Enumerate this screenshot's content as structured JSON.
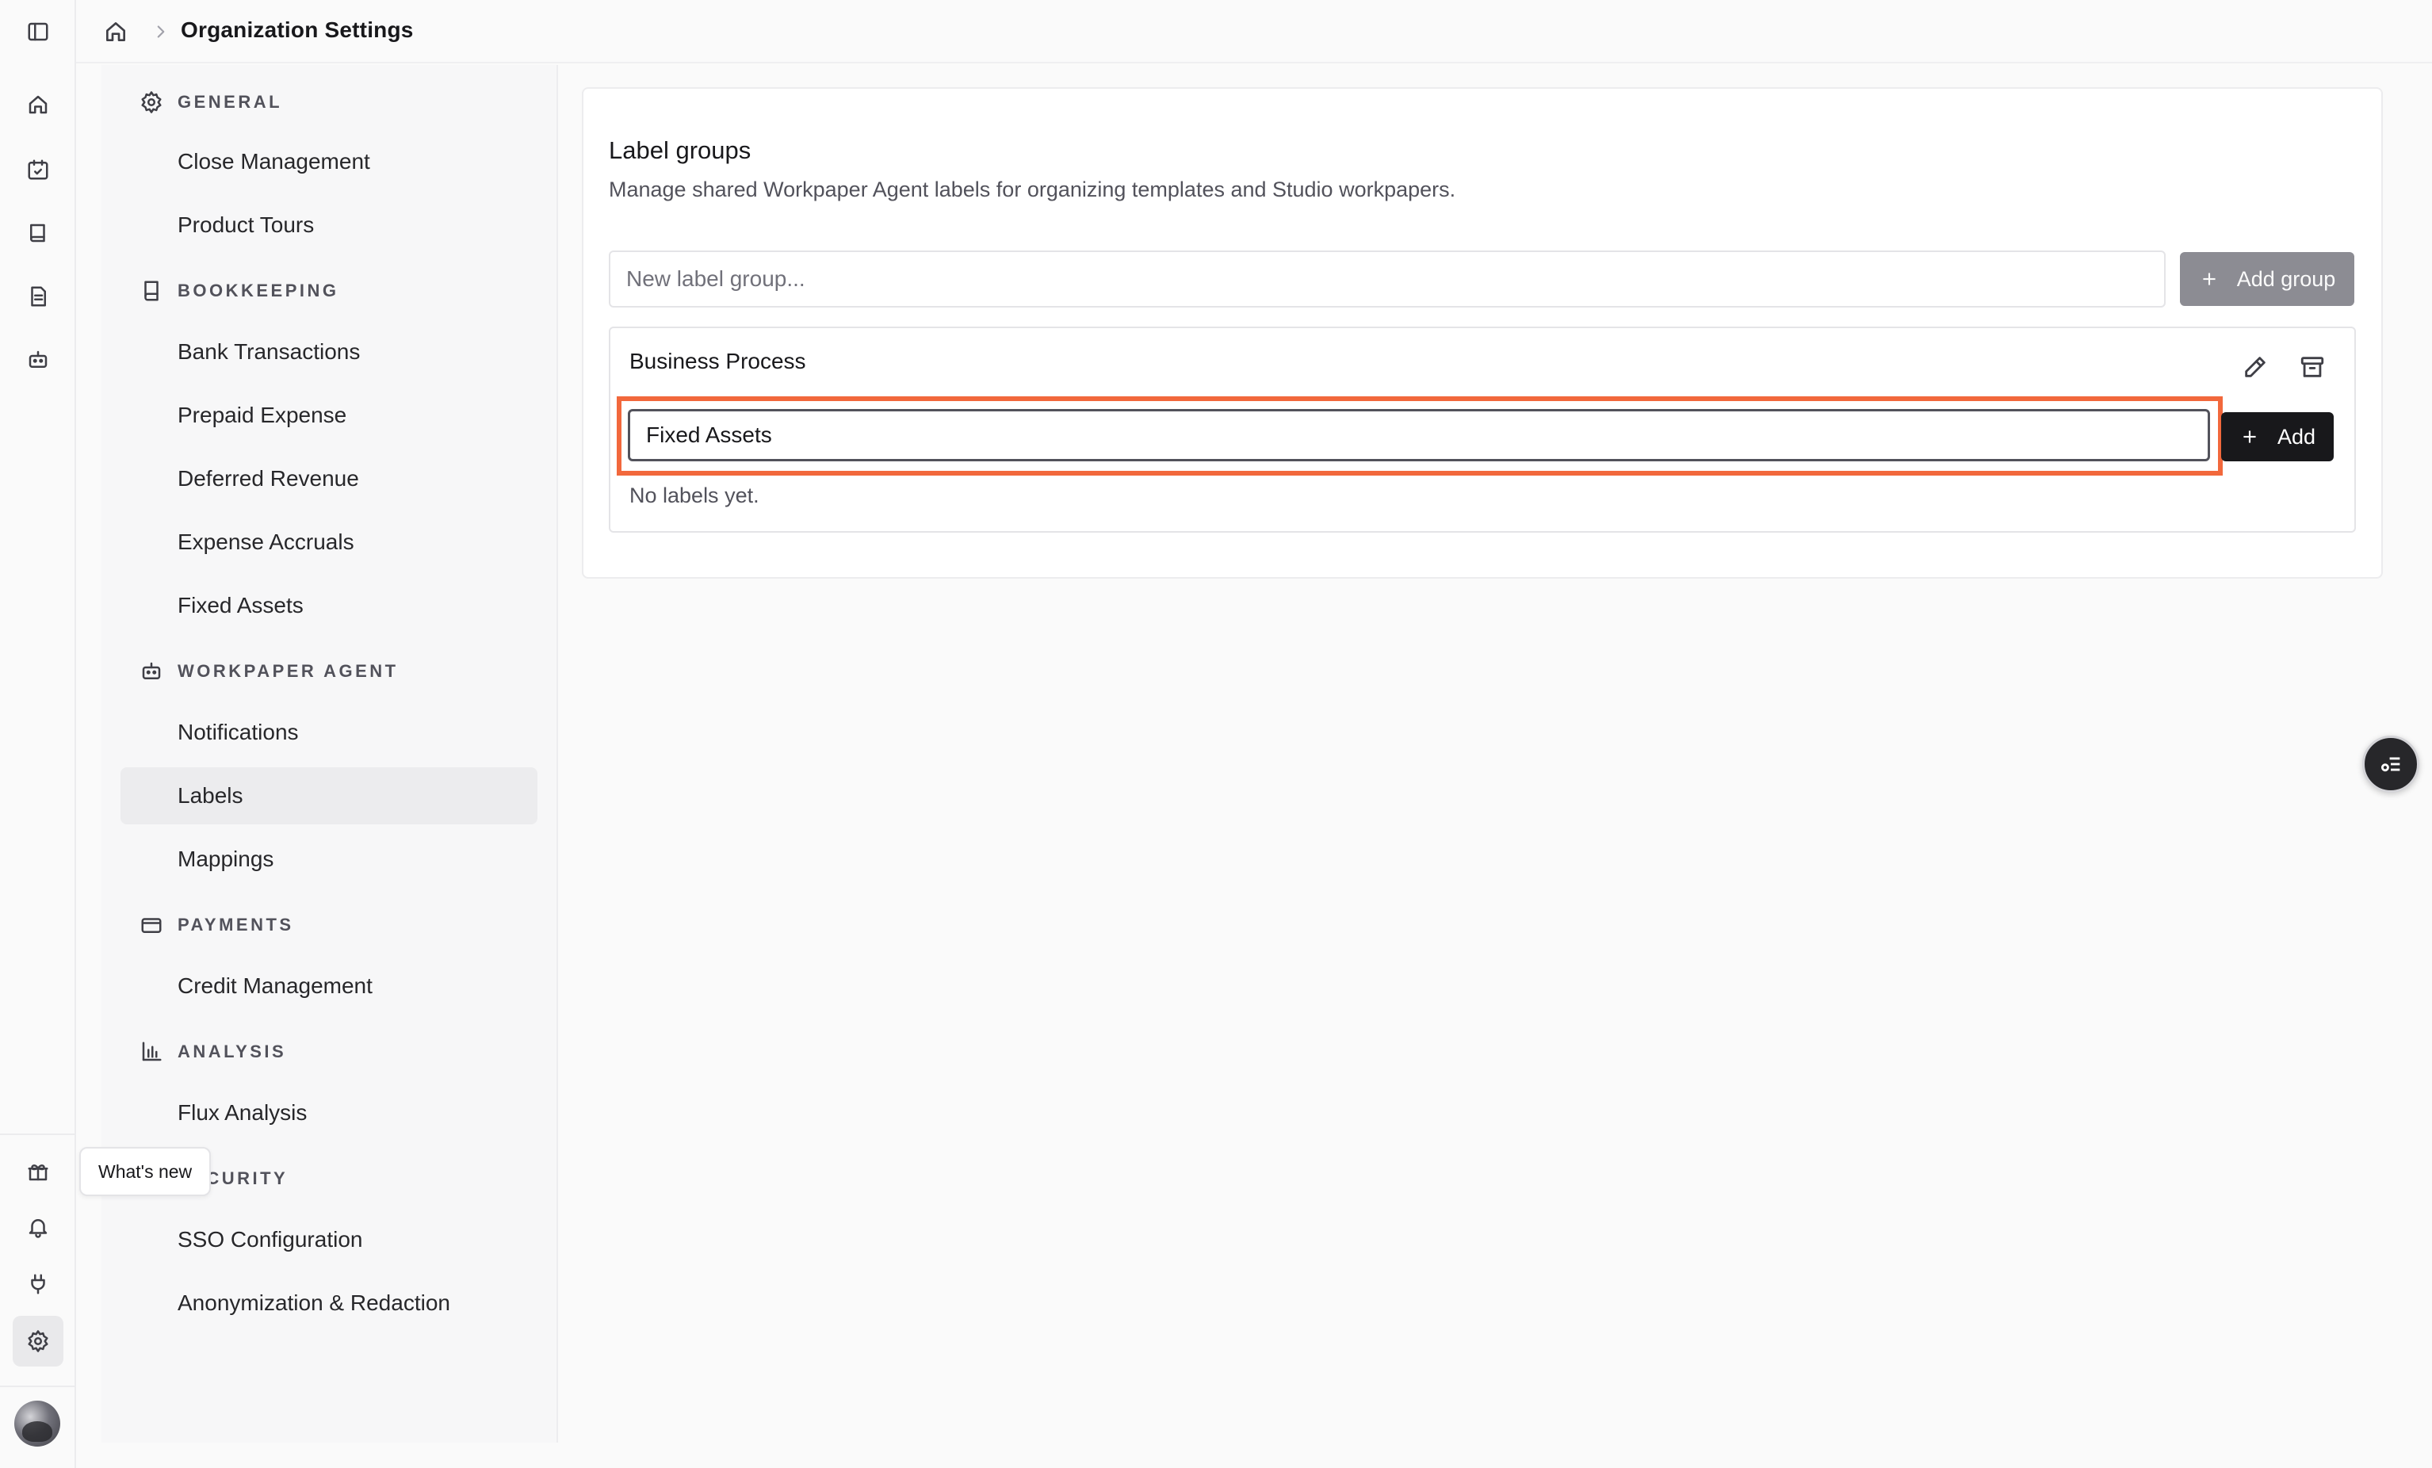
{
  "header": {
    "title": "Organization Settings"
  },
  "nav": {
    "sections": [
      {
        "key": "general",
        "label": "GENERAL",
        "icon": "gear-icon",
        "items": [
          "Close Management",
          "Product Tours"
        ]
      },
      {
        "key": "bookkeeping",
        "label": "BOOKKEEPING",
        "icon": "book-icon",
        "items": [
          "Bank Transactions",
          "Prepaid Expense",
          "Deferred Revenue",
          "Expense Accruals",
          "Fixed Assets"
        ]
      },
      {
        "key": "workpaper",
        "label": "WORKPAPER AGENT",
        "icon": "robot-icon",
        "items": [
          "Notifications",
          "Labels",
          "Mappings"
        ]
      },
      {
        "key": "payments",
        "label": "PAYMENTS",
        "icon": "credit-card-icon",
        "items": [
          "Credit Management"
        ]
      },
      {
        "key": "analysis",
        "label": "ANALYSIS",
        "icon": "bar-chart-icon",
        "items": [
          "Flux Analysis"
        ]
      },
      {
        "key": "security",
        "label": "SECURITY",
        "icon": "shield-icon",
        "items": [
          "SSO Configuration",
          "Anonymization & Redaction"
        ]
      }
    ],
    "active_item": "Labels"
  },
  "tooltip": {
    "text": "What's new"
  },
  "main": {
    "title": "Label groups",
    "description": "Manage shared Workpaper Agent labels for organizing templates and Studio workpapers.",
    "new_group_placeholder": "New label group...",
    "add_group_label": "Add group",
    "group": {
      "name": "Business Process",
      "label_input_value": "Fixed Assets",
      "add_label": "Add",
      "empty_text": "No labels yet."
    }
  },
  "colors": {
    "accent": "#f2683c",
    "primary_button": "#18181b",
    "disabled_button": "#8c8c93"
  }
}
